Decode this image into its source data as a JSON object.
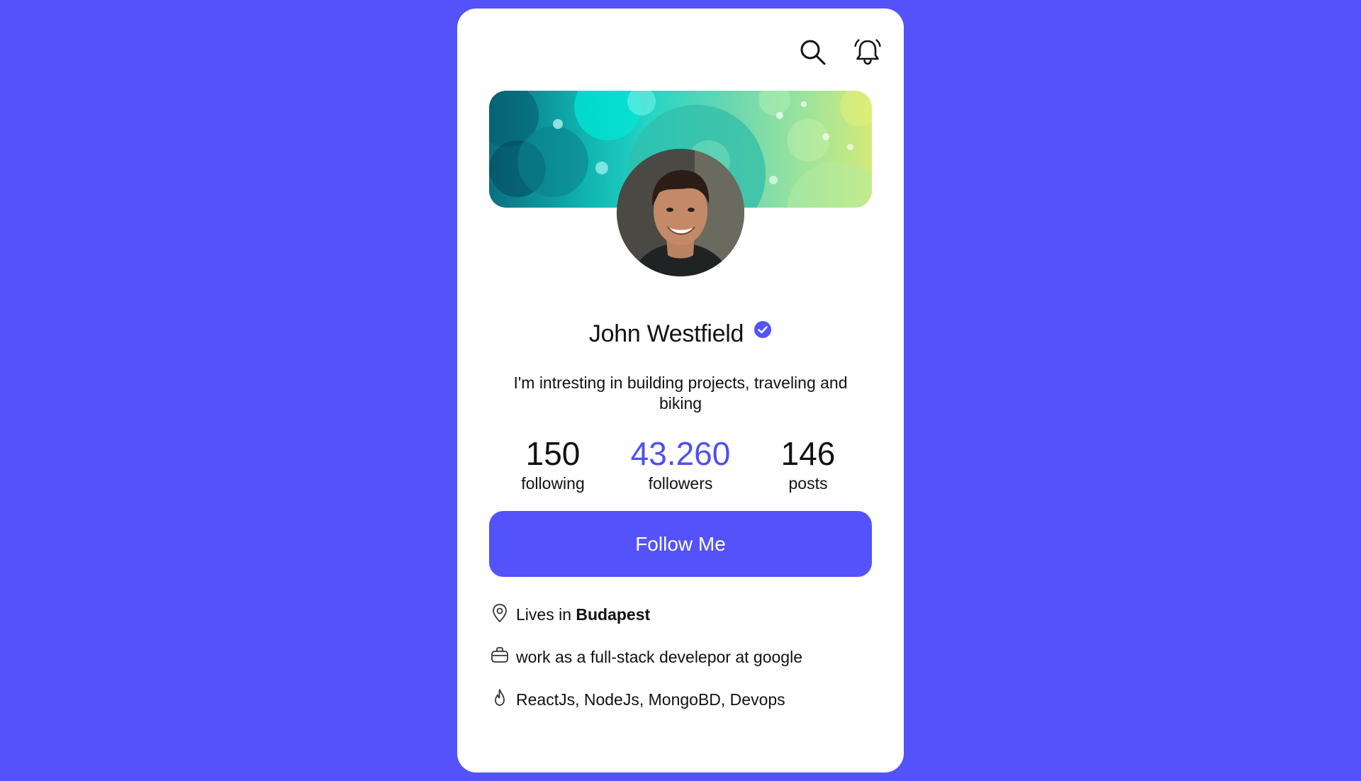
{
  "header": {
    "search_icon": "search-icon",
    "notifications_icon": "bell-icon"
  },
  "profile": {
    "name": "John Westfield",
    "verified": true,
    "bio": "I'm intresting in building projects, traveling and biking"
  },
  "stats": [
    {
      "value": "150",
      "label": "following",
      "accent": false
    },
    {
      "value": "43.260",
      "label": "followers",
      "accent": true
    },
    {
      "value": "146",
      "label": "posts",
      "accent": false
    }
  ],
  "follow_button": {
    "label": "Follow Me"
  },
  "details": {
    "location_prefix": "Lives in ",
    "location_city": "Budapest",
    "work": "work as a full-stack develepor at google",
    "skills": "ReactJs, NodeJs, MongoBD, Devops"
  },
  "colors": {
    "background": "#5352fb",
    "accent": "#4f4ff0",
    "card": "#ffffff"
  }
}
